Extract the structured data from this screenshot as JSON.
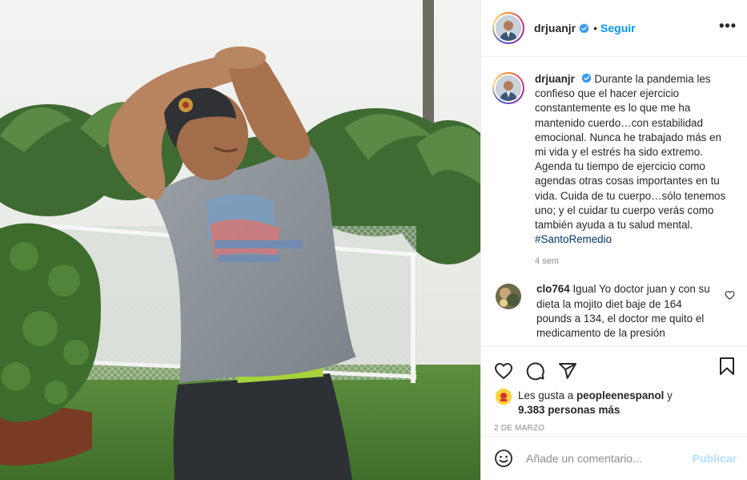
{
  "post": {
    "photo_alt": "Hombre con gorra y camiseta gris estirándose en un jardín"
  },
  "header": {
    "username": "drjuanjr",
    "separator": "•",
    "follow_label": "Seguir",
    "more_label": "•••"
  },
  "caption": {
    "username": "drjuanjr",
    "text": "Durante la pandemia les confieso que el hacer ejercicio constantemente es lo que me ha mantenido cuerdo…con estabilidad emocional. Nunca he trabajado más en mi vida y el estrés ha sido extremo. Agenda tu tiempo de ejercicio como agendas otras cosas importantes en tu vida. Cuida de tu cuerpo…sólo tenemos uno; y el cuidar tu cuerpo verás como también ayuda a tu salud mental.",
    "hashtag": "#SantoRemedio",
    "time": "4 sem"
  },
  "comment": {
    "username": "clo764",
    "text": "Igual Yo doctor juan y con su dieta la mojito diet baje de 164 pounds a 134, el doctor me quito el medicamento de la presión"
  },
  "likes": {
    "prefix": "Les gusta a",
    "user": "peopleenespanol",
    "conjunction": "y",
    "others": "9.383 personas más"
  },
  "date": "2 DE MARZO",
  "add_comment": {
    "placeholder": "Añade un comentario...",
    "publish_label": "Publicar"
  },
  "colors": {
    "accent": "#0095f6",
    "hashtag": "#00376b",
    "muted": "#8e8e8e",
    "publish_disabled": "#b2dffc"
  },
  "icons": {
    "verified": "verified-badge-icon",
    "more": "more-options-icon",
    "like": "heart-icon",
    "comment": "comment-bubble-icon",
    "share": "paper-plane-icon",
    "save": "bookmark-icon",
    "emoji": "emoji-icon",
    "comment_like": "heart-icon"
  }
}
